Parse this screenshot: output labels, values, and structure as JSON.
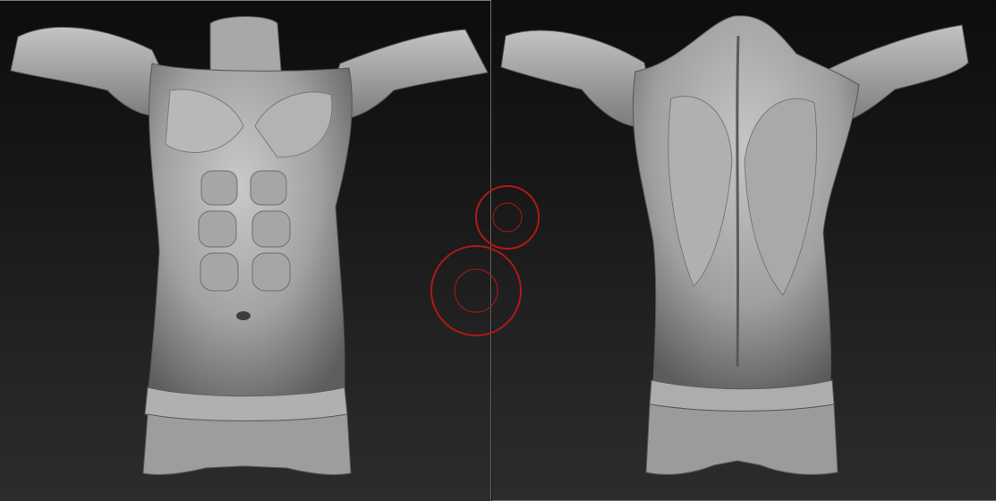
{
  "viewports": [
    {
      "view": "front",
      "subject": "torso-front"
    },
    {
      "view": "back",
      "subject": "torso-back"
    }
  ],
  "brush_cursor": {
    "color": "#b01818"
  },
  "colors": {
    "background_top": "#0d0d0d",
    "background_bottom": "#2c2c2c",
    "clay": "#a9a9a9"
  }
}
